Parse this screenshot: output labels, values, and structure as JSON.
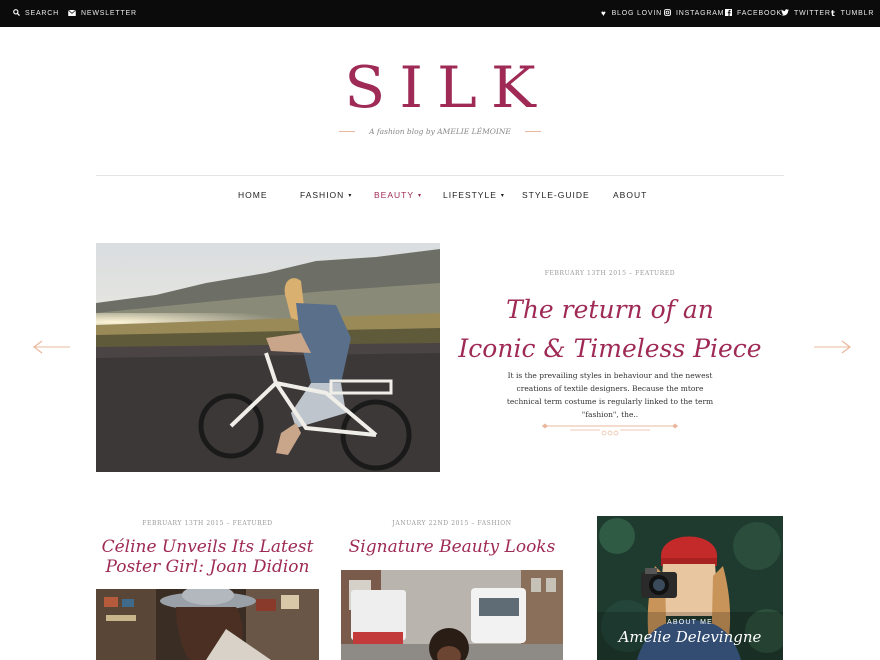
{
  "topbar": {
    "left": [
      {
        "icon": "search-icon",
        "label": "SEARCH"
      },
      {
        "icon": "envelope-icon",
        "label": "NEWSLETTER"
      }
    ],
    "right": [
      {
        "icon": "heart-icon",
        "label": "BLOG LOVIN"
      },
      {
        "icon": "instagram-icon",
        "label": "INSTAGRAM"
      },
      {
        "icon": "facebook-icon",
        "label": "FACEBOOK"
      },
      {
        "icon": "twitter-icon",
        "label": "TWITTER"
      },
      {
        "icon": "tumblr-icon",
        "label": "TUMBLR"
      }
    ]
  },
  "site": {
    "logo": "SILK",
    "tagline": "A fashion blog by AMELIE LÉMOINE"
  },
  "nav": {
    "items": [
      {
        "label": "HOME",
        "dropdown": false,
        "active": false
      },
      {
        "label": "FASHION",
        "dropdown": true,
        "active": false
      },
      {
        "label": "BEAUTY",
        "dropdown": true,
        "active": true
      },
      {
        "label": "LIFESTYLE",
        "dropdown": true,
        "active": false
      },
      {
        "label": "STYLE-GUIDE",
        "dropdown": false,
        "active": false
      },
      {
        "label": "ABOUT",
        "dropdown": false,
        "active": false
      }
    ],
    "caret": "▾"
  },
  "hero": {
    "meta": "FEBRUARY 13TH 2015 – FEATURED",
    "title_line1": "The return of an",
    "title_line2": "Iconic & Timeless Piece",
    "excerpt": "It is the prevailing styles in behaviour and the newest creations of textile designers. Because the mtore technical term costume is regularly linked to the term \"fashion\", the..",
    "image": "woman riding a white bicycle on a road at sunset with mountains"
  },
  "cards": [
    {
      "meta": "FEBRUARY 13TH 2015 – FEATURED",
      "title_line1": "Céline Unveils Its Latest",
      "title_line2": "Poster Girl: Joan Didion",
      "image": "woman in grey hat in a store"
    },
    {
      "meta": "JANUARY 22ND 2015 – FASHION",
      "title_line1": "Signature Beauty Looks",
      "title_line2": "",
      "image": "city street with trucks and a woman with curly hair"
    }
  ],
  "about": {
    "label": "ABOUT ME",
    "name": "Amelie Delevingne",
    "image": "woman in red beanie holding a camera"
  },
  "colors": {
    "accent": "#9e2a55",
    "ornament": "#e9b89c",
    "topbar": "#0b0b0b"
  }
}
